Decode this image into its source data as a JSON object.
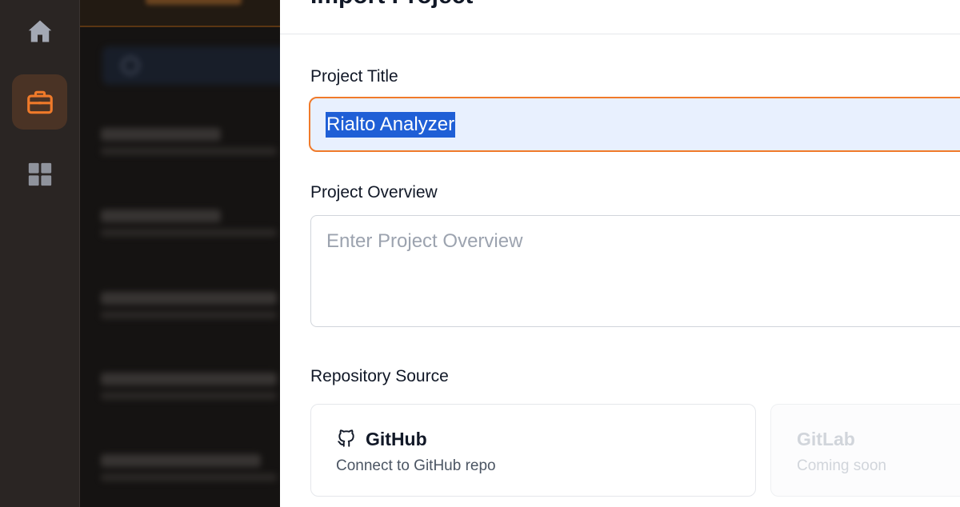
{
  "rail": {
    "items": [
      {
        "id": "home",
        "icon": "home-icon",
        "active": false
      },
      {
        "id": "projects",
        "icon": "briefcase-icon",
        "active": true
      },
      {
        "id": "dashboard",
        "icon": "grid-icon",
        "active": false
      }
    ],
    "colors": {
      "active_accent": "#f07a2a",
      "inactive_icon": "#9ca3af"
    }
  },
  "modal": {
    "title": "Import Project",
    "project_title": {
      "label": "Project Title",
      "value": "Rialto Analyzer"
    },
    "project_overview": {
      "label": "Project Overview",
      "placeholder": "Enter Project Overview",
      "value": ""
    },
    "repository_source": {
      "label": "Repository Source",
      "options": [
        {
          "name": "GitHub",
          "description": "Connect to GitHub repo",
          "icon": "github-icon",
          "enabled": true
        },
        {
          "name": "GitLab",
          "description": "Coming soon",
          "enabled": false
        }
      ]
    },
    "colors": {
      "focus_border": "#f07a2a",
      "selection": "#1f5fd6",
      "input_bg": "#e8f0fe"
    }
  }
}
